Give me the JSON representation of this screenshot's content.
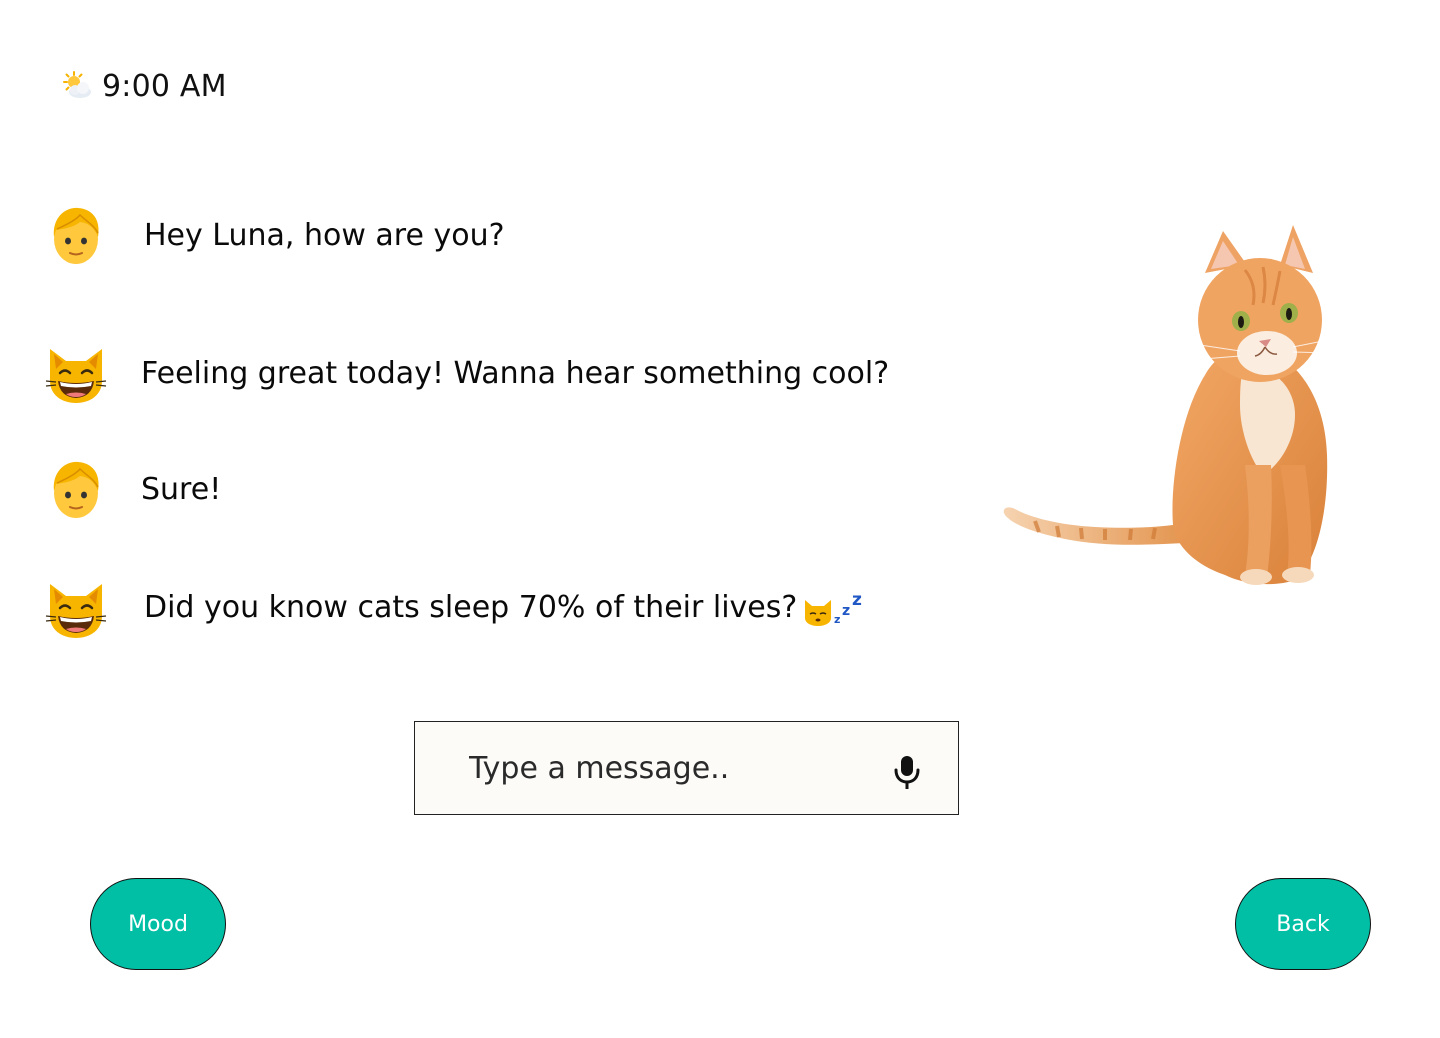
{
  "status_bar": {
    "weather_icon": "sun-behind-cloud-icon",
    "time": "9:00 AM"
  },
  "conversation": [
    {
      "speaker": "user",
      "avatar": "person-blond-icon",
      "text": "Hey Luna, how are you?"
    },
    {
      "speaker": "cat",
      "avatar": "grinning-cat-icon",
      "text": "Feeling great today! Wanna hear something cool?"
    },
    {
      "speaker": "user",
      "avatar": "person-blond-icon",
      "text": "Sure!"
    },
    {
      "speaker": "cat",
      "avatar": "grinning-cat-icon",
      "text": "Did you know cats sleep 70% of their lives?",
      "trailing_emoji": "sleeping-cat-icon"
    }
  ],
  "pet_image": {
    "subject": "orange-tabby-cat"
  },
  "composer": {
    "placeholder": "Type a message..",
    "value": "",
    "mic_icon": "microphone-icon"
  },
  "buttons": {
    "mood": "Mood",
    "back": "Back"
  },
  "colors": {
    "accent": "#00bfa5",
    "composer_bg": "#fcfbf8",
    "text": "#111111"
  }
}
